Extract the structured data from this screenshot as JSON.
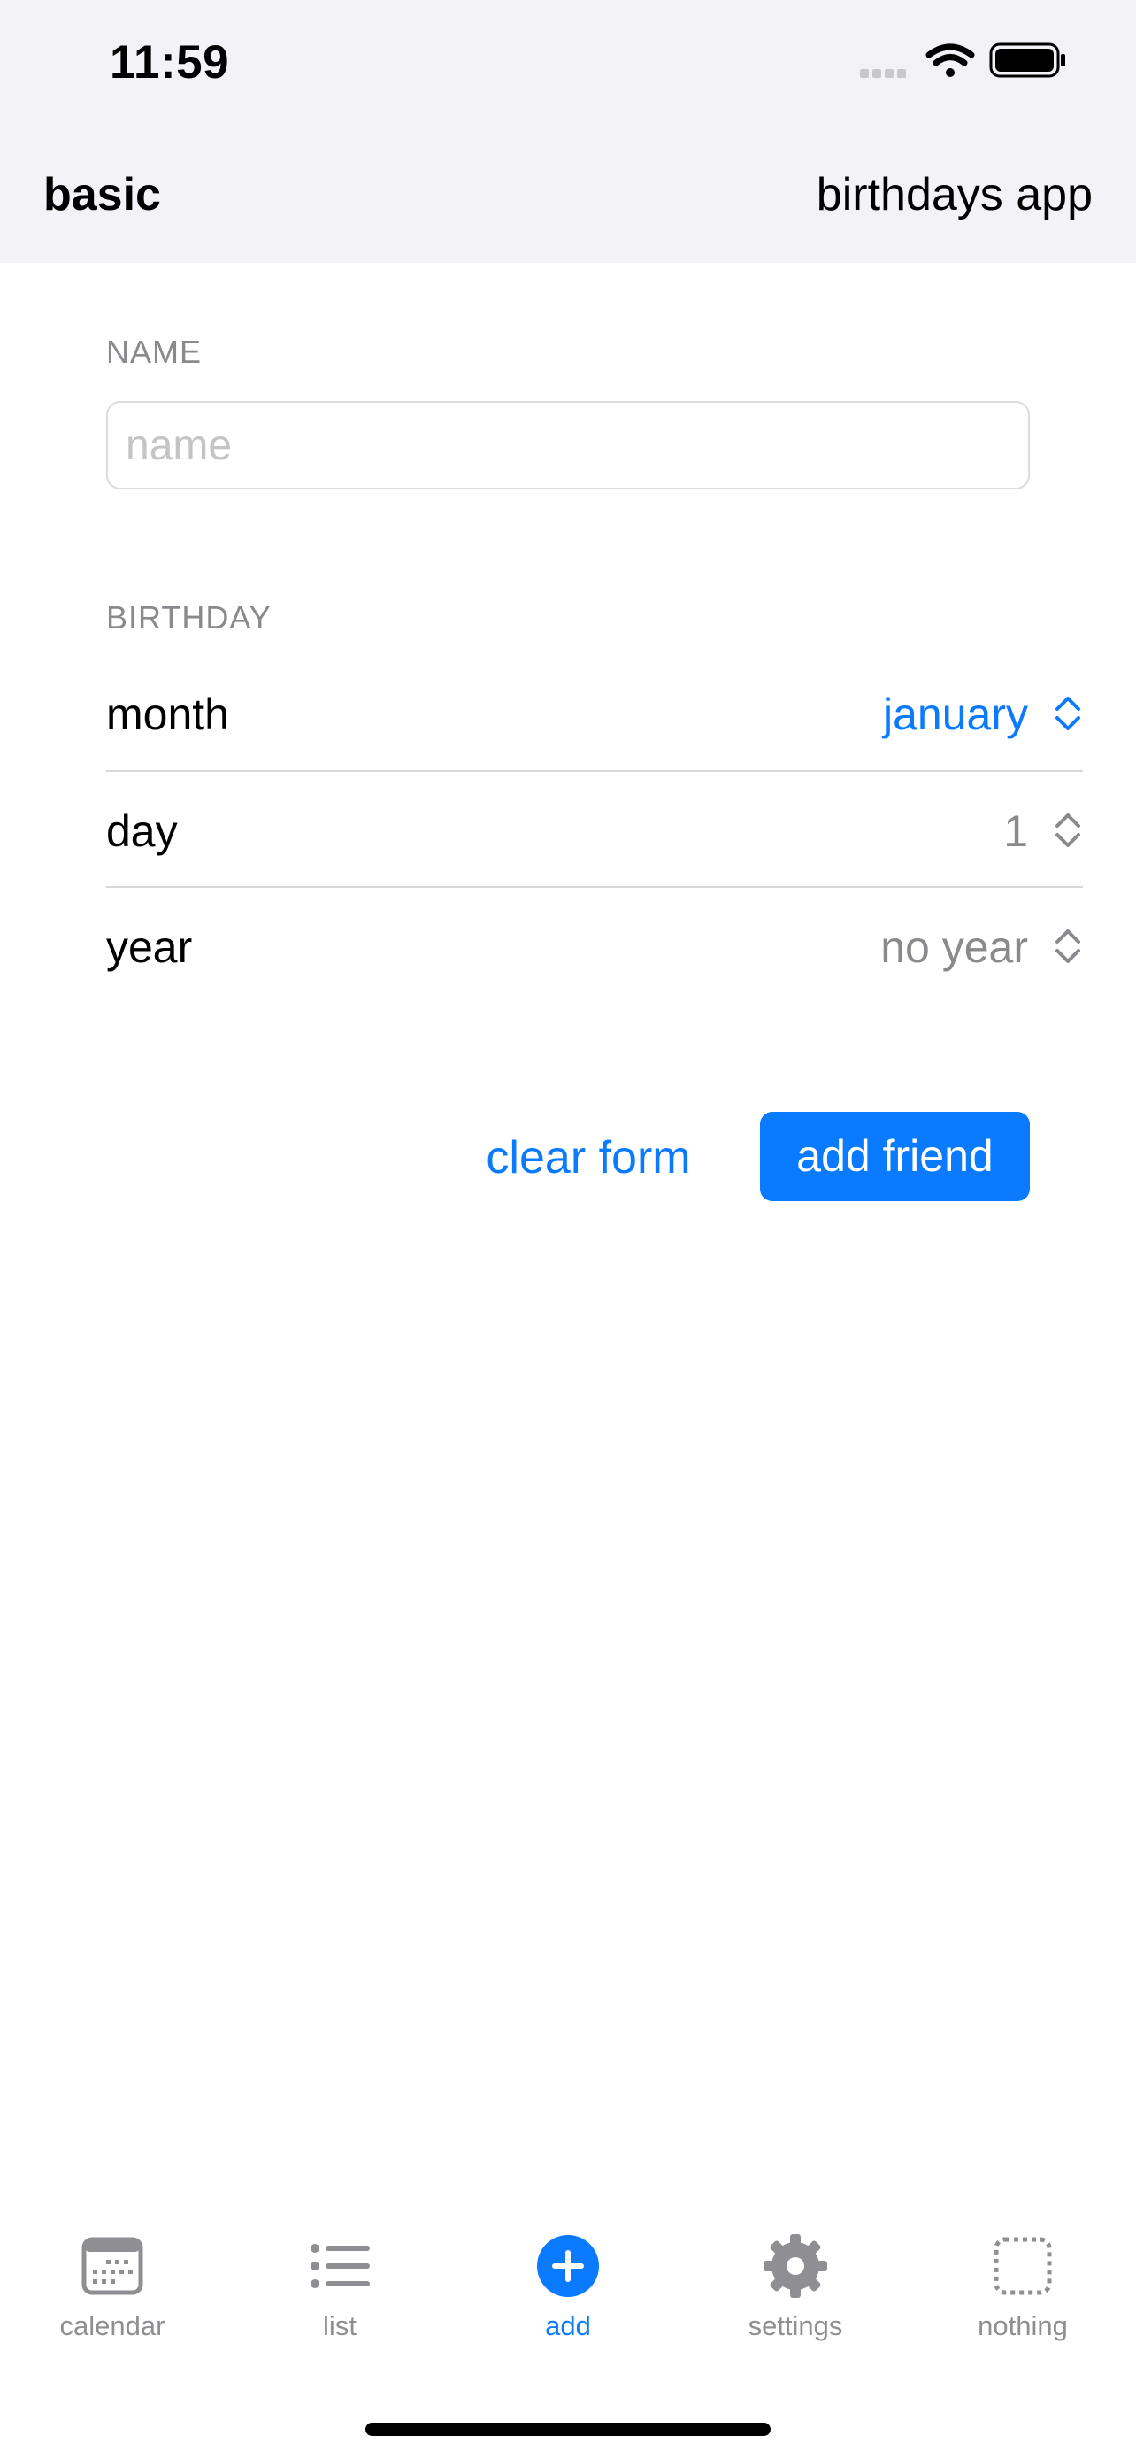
{
  "status_bar": {
    "time": "11:59",
    "icons": [
      "cellular-icon",
      "wifi-icon",
      "battery-icon"
    ]
  },
  "nav": {
    "left_title": "basic",
    "right_title": "birthdays app"
  },
  "form": {
    "name_section_label": "NAME",
    "name_placeholder": "name",
    "name_value": "",
    "birthday_section_label": "BIRTHDAY",
    "rows": [
      {
        "label": "month",
        "value": "january"
      },
      {
        "label": "day",
        "value": "1"
      },
      {
        "label": "year",
        "value": "no year"
      }
    ],
    "clear_label": "clear form",
    "add_label": "add friend"
  },
  "tabs": [
    {
      "label": "calendar",
      "icon": "calendar-icon"
    },
    {
      "label": "list",
      "icon": "list-icon"
    },
    {
      "label": "add",
      "icon": "plus-circle-icon",
      "active": true
    },
    {
      "label": "settings",
      "icon": "gear-icon"
    },
    {
      "label": "nothing",
      "icon": "dashed-square-icon"
    }
  ],
  "colors": {
    "accent": "#0a7aff",
    "inactive_tab": "#8e8e93",
    "secondary_text": "#8a8a8e",
    "header_bg": "#f2f2f7"
  }
}
